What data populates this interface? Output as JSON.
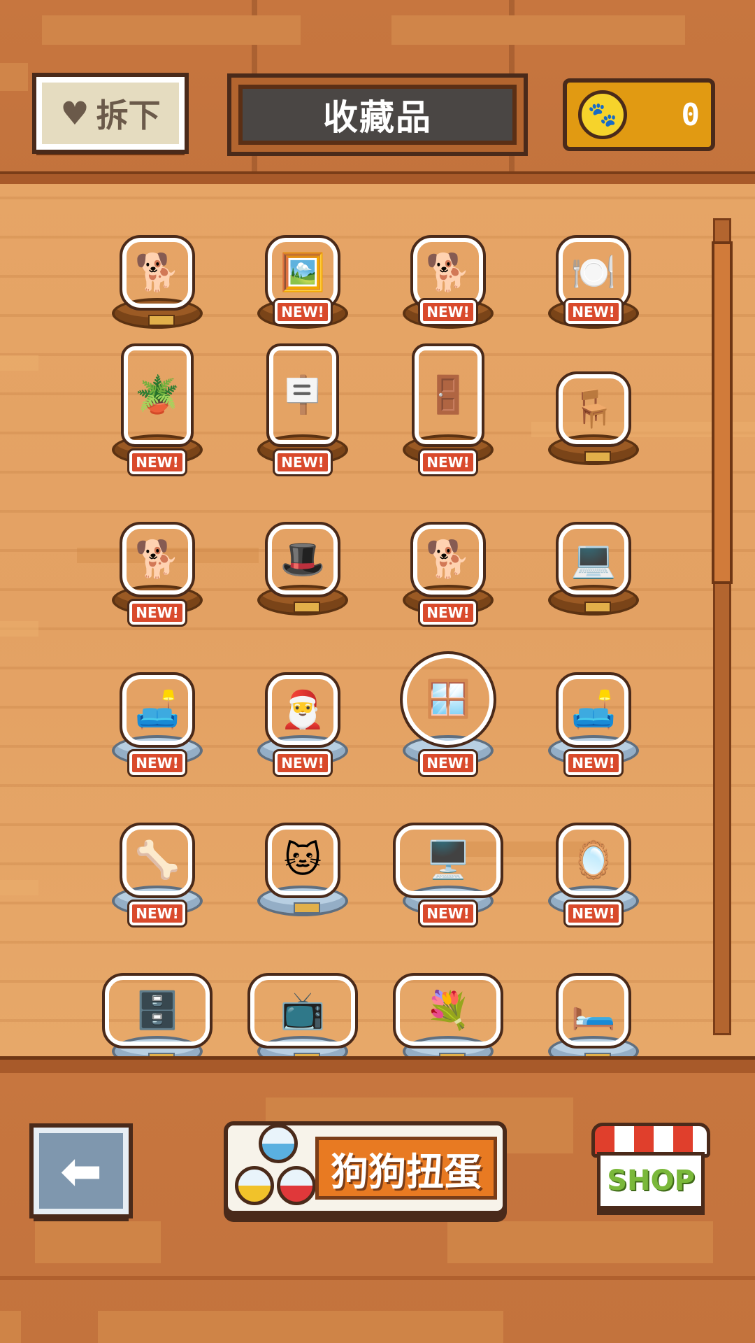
{
  "header": {
    "remove_button_label": "拆下",
    "title": "收藏品",
    "coin_count": "0"
  },
  "collection": {
    "new_badge_label": "NEW!",
    "items": [
      {
        "icon": "🐕",
        "base": "wood",
        "is_new": false
      },
      {
        "icon": "🖼️",
        "base": "wood",
        "is_new": false
      },
      {
        "icon": "🐕",
        "base": "wood",
        "is_new": false
      },
      {
        "icon": "🍽️",
        "base": "wood",
        "is_new": false
      },
      {
        "icon": "🪴",
        "base": "wood",
        "is_new": false
      },
      {
        "icon": "🪧",
        "base": "wood",
        "is_new": true
      },
      {
        "icon": "🚪",
        "base": "wood",
        "is_new": true
      },
      {
        "icon": "🪑",
        "base": "wood",
        "is_new": true
      },
      {
        "icon": "🐕",
        "base": "wood",
        "is_new": true
      },
      {
        "icon": "🎩",
        "base": "wood",
        "is_new": true
      },
      {
        "icon": "🐕",
        "base": "wood",
        "is_new": true
      },
      {
        "icon": "💻",
        "base": "wood",
        "is_new": false
      },
      {
        "icon": "🛋️",
        "base": "glass",
        "is_new": true
      },
      {
        "icon": "🎅",
        "base": "glass",
        "is_new": false
      },
      {
        "icon": "🪟",
        "base": "glass",
        "is_new": true
      },
      {
        "icon": "🛋️",
        "base": "glass",
        "is_new": false
      },
      {
        "icon": "🦴",
        "base": "glass",
        "is_new": true
      },
      {
        "icon": "🐱",
        "base": "glass",
        "is_new": true
      },
      {
        "icon": "🖥️",
        "base": "glass",
        "is_new": true
      },
      {
        "icon": "🪞",
        "base": "glass",
        "is_new": true
      },
      {
        "icon": "🗄️",
        "base": "glass",
        "is_new": true
      },
      {
        "icon": "📺",
        "base": "glass",
        "is_new": false
      },
      {
        "icon": "💐",
        "base": "glass",
        "is_new": true
      },
      {
        "icon": "🛏️",
        "base": "glass",
        "is_new": true
      }
    ]
  },
  "footer": {
    "gacha_label": "狗狗扭蛋",
    "shop_label": "SHOP",
    "back_icon": "back-arrow-icon"
  },
  "colors": {
    "new_badge": "#d94a2c",
    "coin_box": "#e19a12",
    "gacha_label_bg": "#e87a22",
    "shop_text": "#7ab83a"
  }
}
